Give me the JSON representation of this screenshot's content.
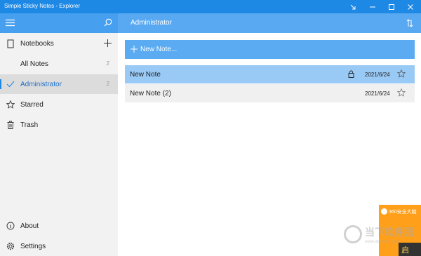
{
  "window": {
    "title": "Simple Sticky Notes - Explorer"
  },
  "header": {
    "notebook_title": "Administrator"
  },
  "sidebar": {
    "notebooks_label": "Notebooks",
    "items": [
      {
        "label": "All Notes",
        "count": "2"
      },
      {
        "label": "Administrator",
        "count": "2"
      },
      {
        "label": "Starred",
        "count": ""
      },
      {
        "label": "Trash",
        "count": ""
      }
    ],
    "about_label": "About",
    "settings_label": "Settings"
  },
  "main": {
    "new_note_label": "New Note...",
    "notes": [
      {
        "title": "New Note",
        "date": "2021/6/24",
        "locked": true
      },
      {
        "title": "New Note (2)",
        "date": "2021/6/24",
        "locked": false
      }
    ]
  },
  "ad": {
    "text": "360安全大脑",
    "button": "启"
  },
  "watermark": {
    "brand": "当下软件园",
    "url": "www.downxia.com"
  },
  "colors": {
    "titlebar": "#1e88e5",
    "accent": "#5aabf1",
    "selected_row": "#99c9f5"
  }
}
